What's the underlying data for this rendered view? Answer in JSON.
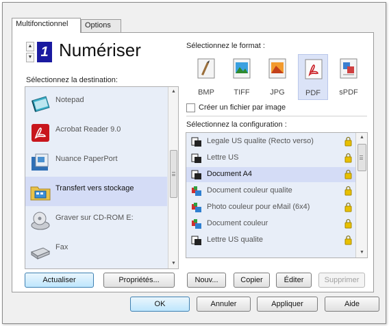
{
  "tabs": [
    {
      "label": "Multifonctionnel",
      "active": true
    },
    {
      "label": "Options",
      "active": false
    }
  ],
  "counter": {
    "value": "1"
  },
  "action_title": "Numériser",
  "destination": {
    "label": "Sélectionnez la destination:",
    "items": [
      {
        "label": "Notepad",
        "icon": "notepad-icon"
      },
      {
        "label": "Acrobat Reader 9.0",
        "icon": "acrobat-icon"
      },
      {
        "label": "Nuance PaperPort",
        "icon": "paperport-icon"
      },
      {
        "label": "Transfert vers stockage",
        "icon": "storage-folder-icon",
        "selected": true
      },
      {
        "label": "Graver sur CD-ROM  E:",
        "icon": "cd-burn-icon"
      },
      {
        "label": "Fax",
        "icon": "fax-icon"
      }
    ],
    "buttons": {
      "refresh": "Actualiser",
      "properties": "Propriétés..."
    }
  },
  "format": {
    "label": "Sélectionnez le format :",
    "items": [
      {
        "label": "BMP",
        "icon": "bmp-icon"
      },
      {
        "label": "TIFF",
        "icon": "tiff-icon"
      },
      {
        "label": "JPG",
        "icon": "jpg-icon"
      },
      {
        "label": "PDF",
        "icon": "pdf-icon",
        "selected": true
      },
      {
        "label": "sPDF",
        "icon": "spdf-icon"
      }
    ],
    "checkbox_label": "Créer un fichier par image",
    "checkbox_checked": false
  },
  "configuration": {
    "label": "Sélectionnez la configuration :",
    "items": [
      {
        "label": "Legale US qualite (Recto verso)",
        "icon": "bw-document-icon"
      },
      {
        "label": "Lettre US",
        "icon": "bw-document-icon"
      },
      {
        "label": "Document A4",
        "icon": "bw-document-icon",
        "selected": true
      },
      {
        "label": "Document couleur qualite",
        "icon": "color-document-icon"
      },
      {
        "label": "Photo couleur pour eMail (6x4)",
        "icon": "color-document-icon"
      },
      {
        "label": "Document couleur",
        "icon": "color-document-icon"
      },
      {
        "label": "Lettre US qualite",
        "icon": "bw-document-icon"
      }
    ],
    "buttons": {
      "new": "Nouv...",
      "copy": "Copier",
      "edit": "Éditer",
      "delete": "Supprimer"
    }
  },
  "footer": {
    "ok": "OK",
    "cancel": "Annuler",
    "apply": "Appliquer",
    "help": "Aide"
  },
  "colors": {
    "accent": "#1a1aa0",
    "selection": "#d4dcf6",
    "list_bg": "#e8eef8",
    "lock": "#e8c000"
  }
}
